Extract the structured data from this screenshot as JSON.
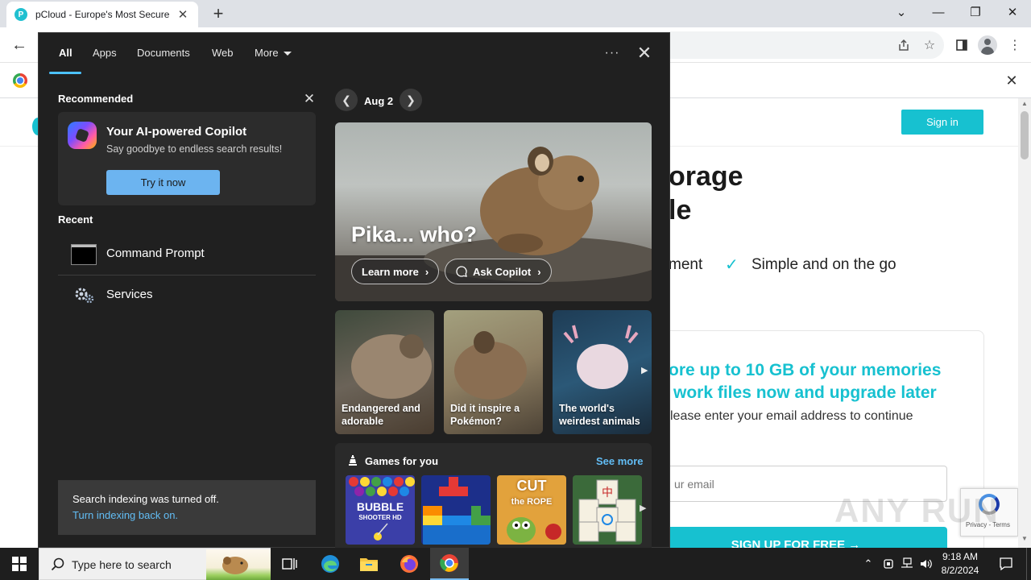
{
  "browser": {
    "tab_title": "pCloud - Europe's Most Secure Cl",
    "tab_favicon_letter": "P",
    "new_tab_symbol": "+",
    "window_controls": {
      "dropdown": "⌄",
      "minimize": "—",
      "restore": "❐",
      "close": "✕"
    }
  },
  "page": {
    "signin_label": "Sign in",
    "hero_line1": "orage",
    "hero_line2": "le",
    "feature_left": "ment",
    "feature_right": "Simple and on the go",
    "promo_line1": "ore up to 10 GB of your memories",
    "promo_line2": "work files now and upgrade later",
    "promo_sub": "lease enter your email address to continue",
    "email_placeholder": "ur email",
    "signup_label": "SIGN UP FOR FREE →",
    "recaptcha_text": "Privacy - Terms",
    "watermark": "ANY RUN"
  },
  "flyout": {
    "tabs": [
      {
        "label": "All",
        "active": true
      },
      {
        "label": "Apps"
      },
      {
        "label": "Documents"
      },
      {
        "label": "Web"
      },
      {
        "label": "More"
      }
    ],
    "more_options": "···",
    "recommended_label": "Recommended",
    "copilot": {
      "title": "Your AI-powered Copilot",
      "subtitle": "Say goodbye to endless search results!",
      "button": "Try it now"
    },
    "recent_label": "Recent",
    "recent_items": [
      {
        "label": "Command Prompt",
        "icon": "command-prompt-icon"
      },
      {
        "label": "Services",
        "icon": "services-gear-icon"
      }
    ],
    "indexing": {
      "message": "Search indexing was turned off.",
      "link": "Turn indexing back on."
    },
    "date_label": "Aug 2",
    "hero": {
      "title": "Pika... who?",
      "learn_more": "Learn more",
      "ask_copilot": "Ask Copilot"
    },
    "thumbs": [
      {
        "caption_line1": "Endangered and",
        "caption_line2": "adorable"
      },
      {
        "caption_line1": "Did it inspire a",
        "caption_line2": "Pokémon?"
      },
      {
        "caption_line1": "The world's",
        "caption_line2": "weirdest animals"
      }
    ],
    "games": {
      "title": "Games for you",
      "see_more": "See more",
      "tiles": [
        {
          "name": "Bubble Shooter",
          "line1": "BUBBLE",
          "line2": "SHOOTER HD",
          "color": "#3b3fa8"
        },
        {
          "name": "Tetris",
          "line1": "",
          "line2": "",
          "color": "#1c2f8a"
        },
        {
          "name": "Cut the Rope",
          "line1": "CUT",
          "line2": "the ROPE",
          "color": "#e2a23c"
        },
        {
          "name": "Mahjong",
          "line1": "",
          "line2": "",
          "color": "#3b6a3a"
        }
      ]
    }
  },
  "taskbar": {
    "search_placeholder": "Type here to search",
    "clock_time": "9:18 AM",
    "clock_date": "8/2/2024"
  },
  "colors": {
    "accent": "#17c1d0",
    "windows_link": "#62bdf5",
    "flyout_bg": "#202020"
  }
}
